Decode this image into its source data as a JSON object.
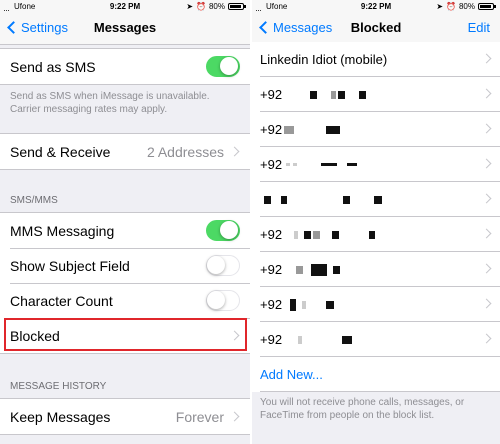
{
  "left": {
    "status": {
      "carrier": "Ufone",
      "time": "9:22 PM",
      "battery": "80%"
    },
    "nav": {
      "back_label": "Settings",
      "title": "Messages"
    },
    "send_as_sms": {
      "label": "Send as SMS",
      "enabled": true
    },
    "sms_note": "Send as SMS when iMessage is unavailable. Carrier messaging rates may apply.",
    "send_receive": {
      "label": "Send & Receive",
      "value": "2 Addresses"
    },
    "sms_mms_header": "SMS/MMS",
    "mms_messaging": {
      "label": "MMS Messaging",
      "enabled": true
    },
    "show_subject": {
      "label": "Show Subject Field",
      "enabled": false
    },
    "character_count": {
      "label": "Character Count",
      "enabled": false
    },
    "blocked": {
      "label": "Blocked"
    },
    "history_header": "MESSAGE HISTORY",
    "keep_messages": {
      "label": "Keep Messages",
      "value": "Forever"
    }
  },
  "right": {
    "status": {
      "carrier": "Ufone",
      "time": "9:22 PM",
      "battery": "80%"
    },
    "nav": {
      "back_label": "Messages",
      "title": "Blocked",
      "edit_label": "Edit"
    },
    "blocked_items": [
      "Linkedin Idiot  (mobile)",
      "+92",
      "+92",
      "+92",
      "",
      "+92",
      "+92",
      "+92",
      "+92"
    ],
    "add_new": "Add New...",
    "footer": "You will not receive phone calls, messages, or FaceTime from people on the block list."
  },
  "colors": {
    "accent": "#007aff",
    "toggle_on": "#4cd964",
    "highlight": "#e0262b"
  }
}
